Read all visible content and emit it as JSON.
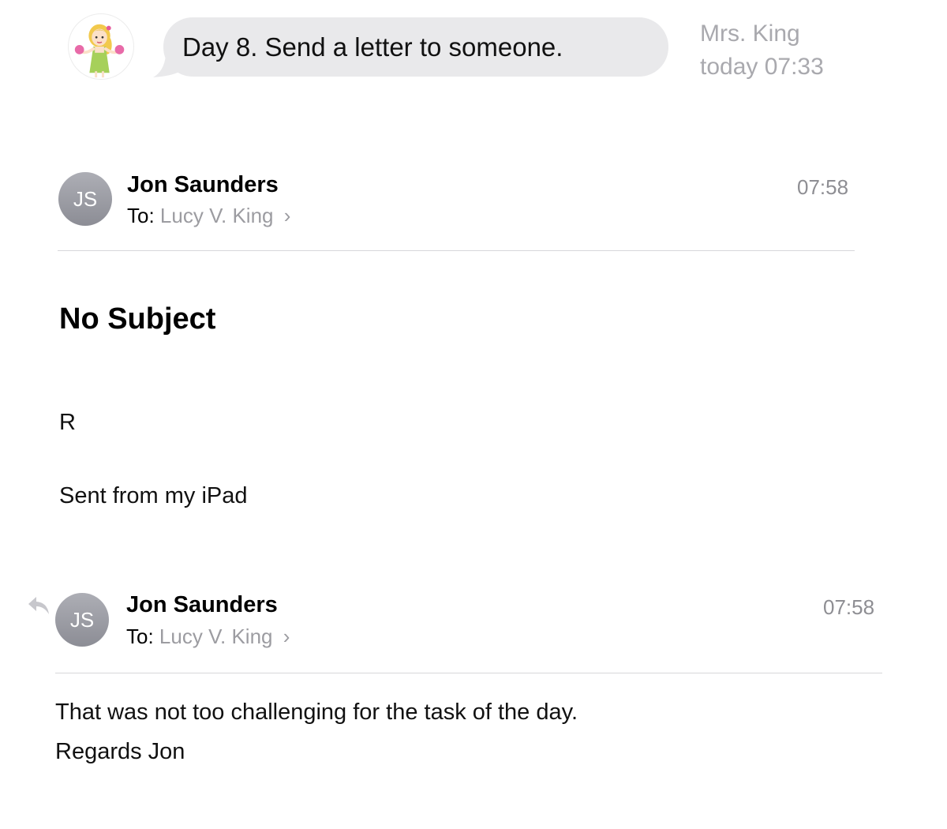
{
  "chat": {
    "message": "Day 8. Send a letter to someone.",
    "sender": "Mrs. King",
    "timestamp": "today 07:33"
  },
  "emails": [
    {
      "avatar_initials": "JS",
      "sender": "Jon Saunders",
      "to_label": "To:",
      "recipient": "Lucy V. King",
      "time": "07:58",
      "subject": "No Subject",
      "body_line1": "R",
      "body_line2": "Sent from my iPad"
    },
    {
      "avatar_initials": "JS",
      "sender": "Jon Saunders",
      "to_label": "To:",
      "recipient": "Lucy V. King",
      "time": "07:58",
      "body_line1": "That was not too challenging for the task of the day.",
      "body_line2": "Regards Jon"
    }
  ],
  "icons": {
    "chevron": "chevron-right-icon",
    "reply": "reply-icon"
  },
  "colors": {
    "bubble": "#e9e9eb",
    "meta_gray": "#a9a9ae",
    "avatar_gray": "#9a9ba2"
  }
}
